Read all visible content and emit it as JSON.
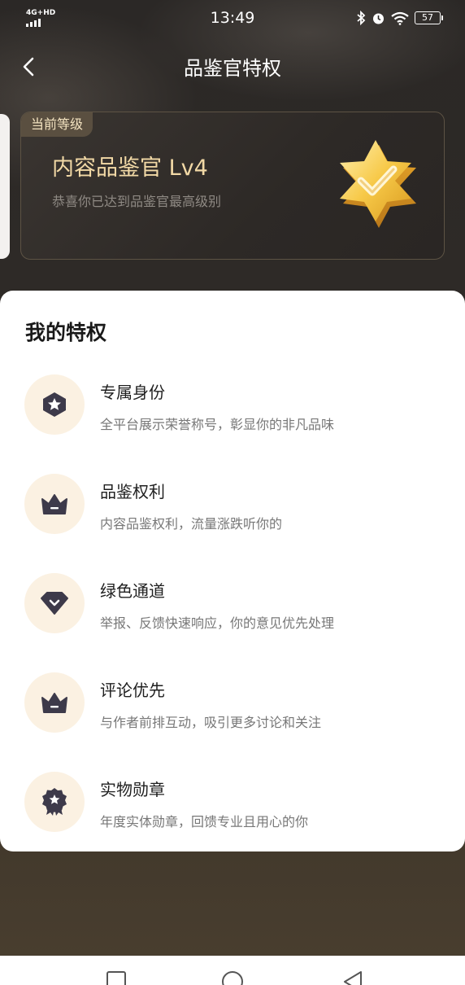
{
  "status_bar": {
    "network": "4G+HD",
    "time": "13:49",
    "battery": "57"
  },
  "nav": {
    "title": "品鉴官特权"
  },
  "level_card": {
    "tag": "当前等级",
    "name": "内容品鉴官 Lv4",
    "desc": "恭喜你已达到品鉴官最高级别"
  },
  "privileges": {
    "title": "我的特权",
    "items": [
      {
        "name": "专属身份",
        "desc": "全平台展示荣誉称号，彰显你的非凡品味",
        "icon": "pentagon-star-icon"
      },
      {
        "name": "品鉴权利",
        "desc": "内容品鉴权利，流量涨跌听你的",
        "icon": "crown-icon"
      },
      {
        "name": "绿色通道",
        "desc": "举报、反馈快速响应，你的意见优先处理",
        "icon": "diamond-check-icon"
      },
      {
        "name": "评论优先",
        "desc": "与作者前排互动，吸引更多讨论和关注",
        "icon": "crown-icon"
      },
      {
        "name": "实物勋章",
        "desc": "年度实体勋章，回馈专业且用心的你",
        "icon": "medal-icon"
      }
    ]
  },
  "colors": {
    "accent_gold": "#f2d9a6",
    "icon_dark": "#3d3a4a",
    "icon_bg": "#fbf1e2"
  }
}
